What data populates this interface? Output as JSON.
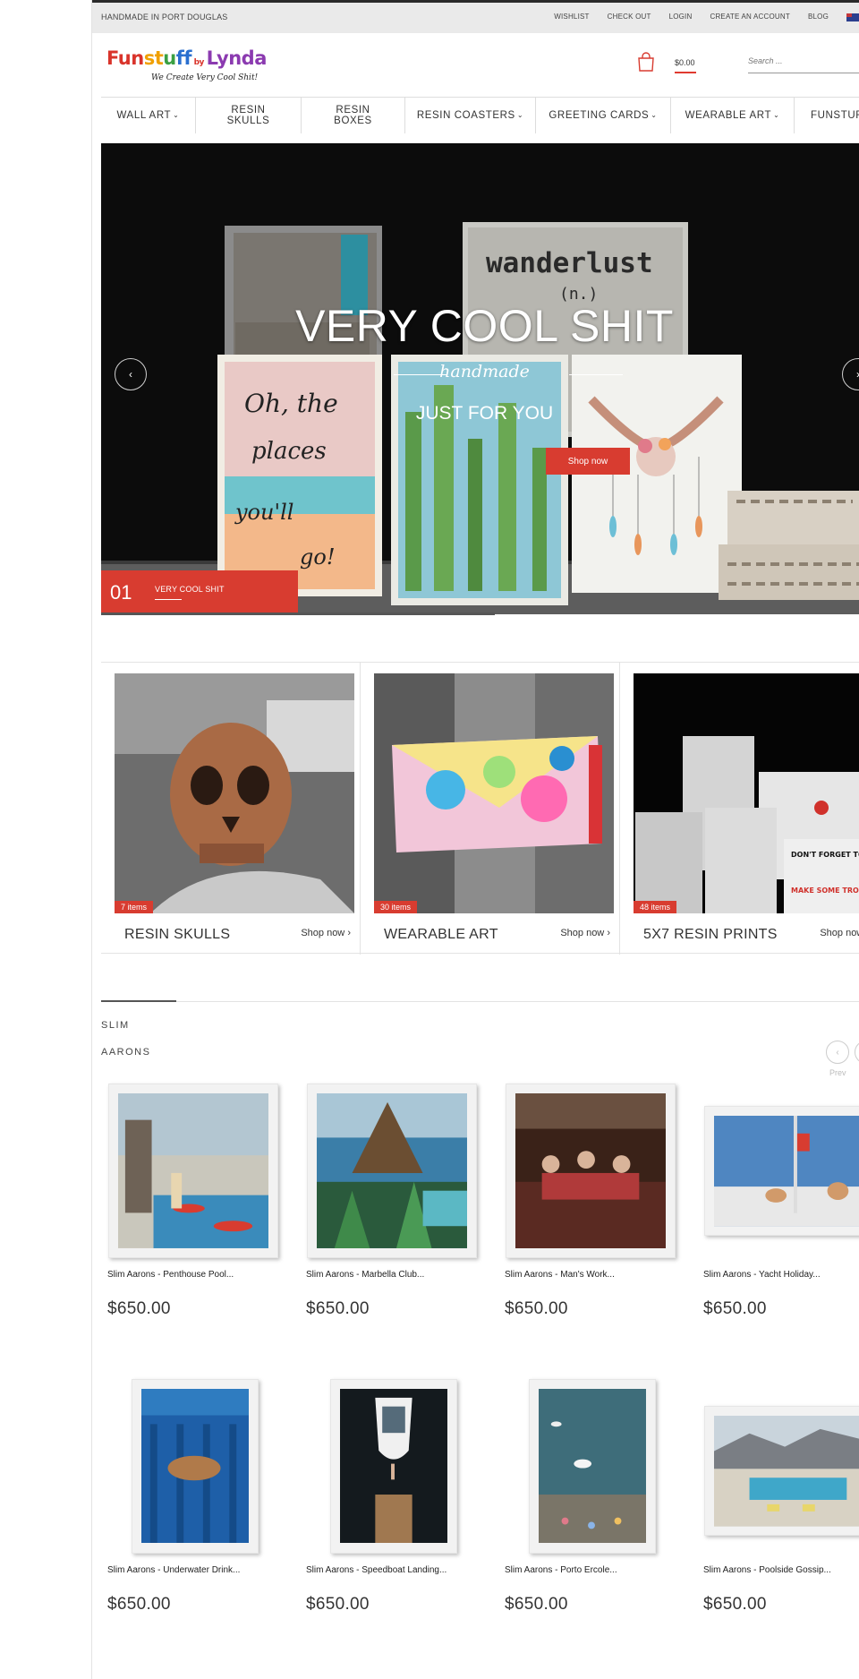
{
  "topbar": {
    "tagline": "HANDMADE IN PORT DOUGLAS",
    "links": [
      "WISHLIST",
      "CHECK OUT",
      "LOGIN",
      "CREATE AN ACCOUNT",
      "BLOG"
    ]
  },
  "logo": {
    "parts": [
      "Fun",
      "st",
      "u",
      "ff",
      " by ",
      "Lynda"
    ],
    "tagline": "We Create Very Cool Shit!"
  },
  "cart": {
    "total": "$0.00"
  },
  "search": {
    "placeholder": "Search ..."
  },
  "nav": {
    "items": [
      {
        "label": "WALL ART",
        "has_dropdown": true
      },
      {
        "label": "RESIN SKULLS",
        "has_dropdown": false
      },
      {
        "label": "RESIN BOXES",
        "has_dropdown": false
      },
      {
        "label": "RESIN COASTERS",
        "has_dropdown": true
      },
      {
        "label": "GREETING CARDS",
        "has_dropdown": true
      },
      {
        "label": "WEARABLE ART",
        "has_dropdown": true
      },
      {
        "label": "FUNSTUFF",
        "has_dropdown": false
      }
    ]
  },
  "hero": {
    "title": "VERY COOL SHIT",
    "subtitle": "handmade",
    "tagline": "JUST FOR YOU",
    "button": "Shop now",
    "slide_number": "01",
    "slide_label": "VERY COOL SHIT",
    "art_texts": [
      "wanderlust",
      "(n.)",
      "Oh, the",
      "places",
      "you'll",
      "go!"
    ]
  },
  "categories": [
    {
      "badge": "7 items",
      "name": "RESIN SKULLS",
      "shop": "Shop now"
    },
    {
      "badge": "30 items",
      "name": "WEARABLE ART",
      "shop": "Shop now"
    },
    {
      "badge": "48 items",
      "name": "5X7 RESIN PRINTS",
      "shop": "Shop now"
    }
  ],
  "category_art_texts": [
    "DON'T FORGET TO EAT YOUR LUNCH AND",
    "MAKE SOME TROUBLE"
  ],
  "section": {
    "title_line1": "SLIM",
    "title_line2": "AARONS",
    "prev_label": "Prev"
  },
  "products": [
    {
      "title": "Slim Aarons - Penthouse Pool...",
      "price": "$650.00"
    },
    {
      "title": "Slim Aarons - Marbella Club...",
      "price": "$650.00"
    },
    {
      "title": "Slim Aarons - Man's Work...",
      "price": "$650.00"
    },
    {
      "title": "Slim Aarons - Yacht Holiday...",
      "price": "$650.00"
    },
    {
      "title": "Slim Aarons - Underwater Drink...",
      "price": "$650.00"
    },
    {
      "title": "Slim Aarons - Speedboat Landing...",
      "price": "$650.00"
    },
    {
      "title": "Slim Aarons - Porto Ercole...",
      "price": "$650.00"
    },
    {
      "title": "Slim Aarons - Poolside Gossip...",
      "price": "$650.00"
    }
  ],
  "colors": {
    "accent": "#d83c30",
    "topbar_bg": "#eaeaea",
    "text": "#333333"
  }
}
